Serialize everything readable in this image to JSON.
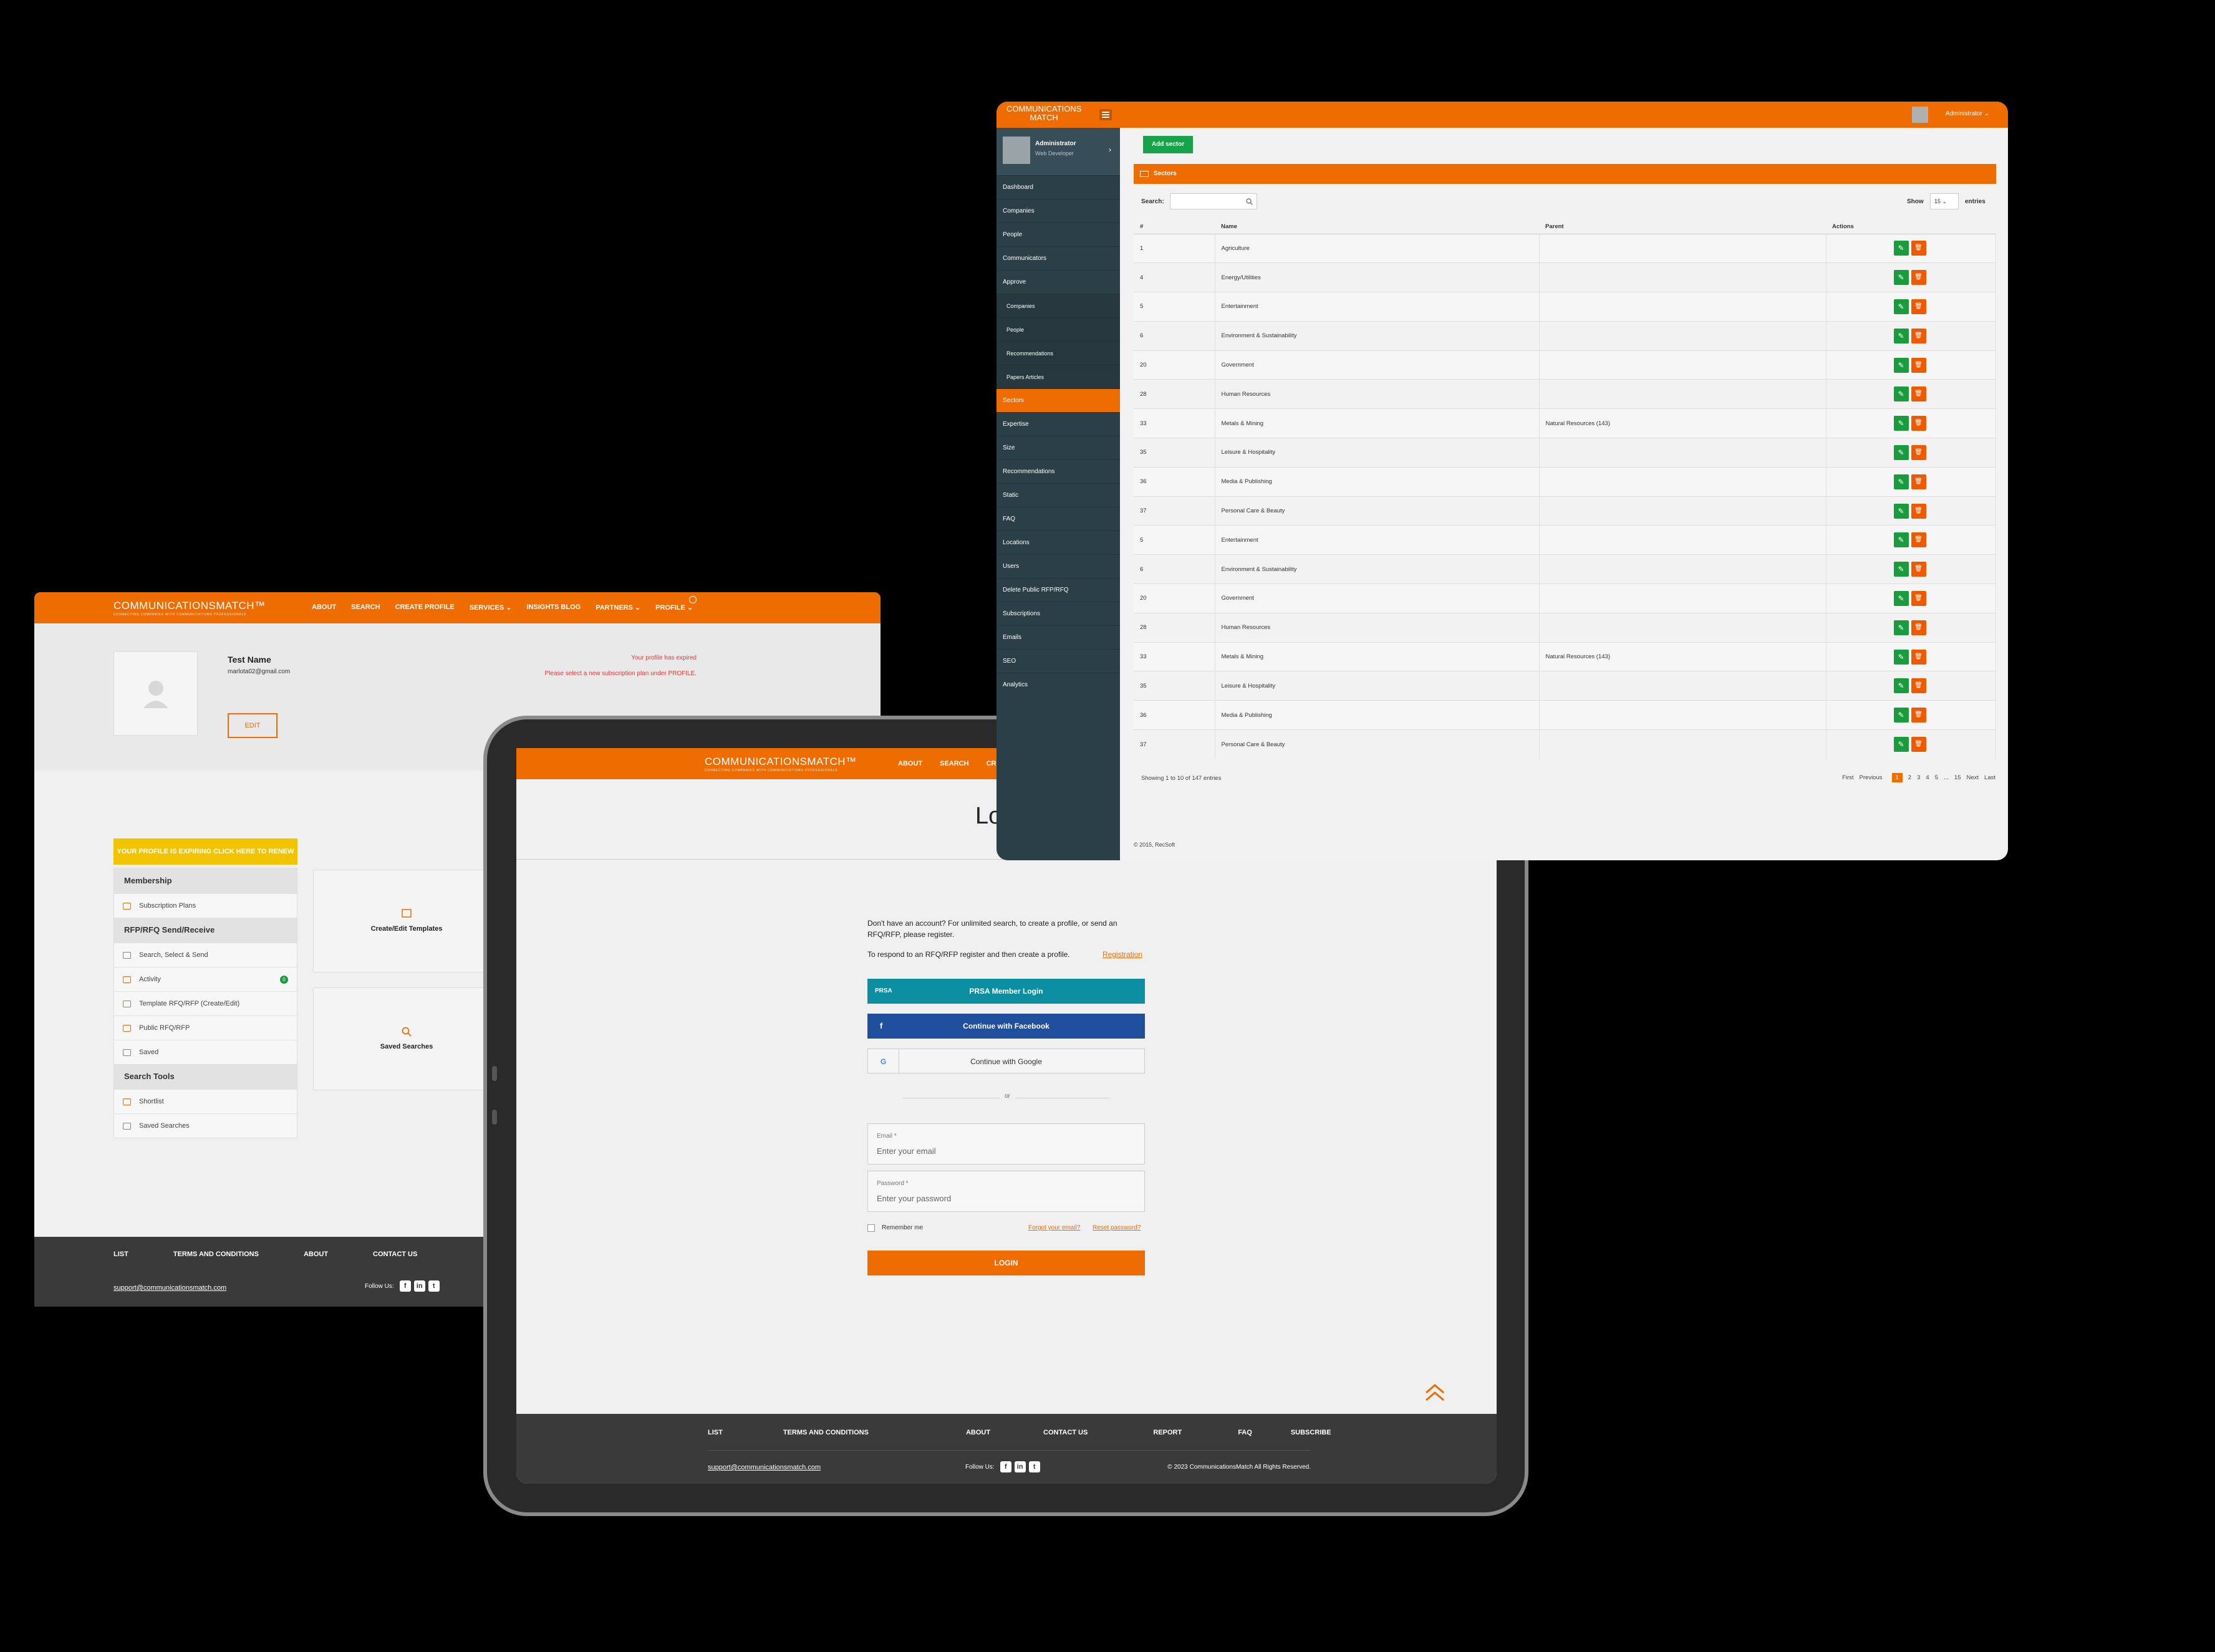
{
  "colors": {
    "brand": "#ef6c00",
    "sidebar": "#2b3f47",
    "edit": "#1a9c3e",
    "delete": "#ef5a00",
    "facebook": "#1f4f9d",
    "prsa": "#0b8fa0",
    "renew": "#f2c400"
  },
  "logo": {
    "name": "COMMUNICATIONSMATCH",
    "mark": "™",
    "tagline": "CONNECTING COMPANIES WITH COMMUNICATIONS PROFESSIONALS"
  },
  "profile": {
    "nav": [
      "ABOUT",
      "SEARCH",
      "CREATE PROFILE",
      "SERVICES ⌄",
      "INSIGHTS BLOG",
      "PARTNERS ⌄",
      "PROFILE ⌄"
    ],
    "name": "Test Name",
    "email": "marlota02@gmail.com",
    "expired_msg": "Your profile has expired",
    "subscribe_msg": "Please select a new subscription plan under PROFILE.",
    "edit": "EDIT",
    "renew": "YOUR PROFILE IS EXPIRING CLICK HERE TO RENEW",
    "sections": [
      {
        "title": "Membership",
        "items": [
          "Subscription Plans"
        ]
      },
      {
        "title": "RFP/RFQ Send/Receive",
        "items": [
          "Search, Select & Send",
          "Activity",
          "Template RFQ/RFP (Create/Edit)",
          "Public RFQ/RFP",
          "Saved"
        ]
      },
      {
        "title": "Search Tools",
        "items": [
          "Shortlist",
          "Saved Searches"
        ]
      }
    ],
    "activity_badge": "0",
    "cards": [
      "Create/Edit Templates",
      "Saved Searches"
    ],
    "footer": {
      "links": [
        "LIST",
        "TERMS AND CONDITIONS",
        "ABOUT",
        "CONTACT US"
      ],
      "email": "support@communicationsmatch.com",
      "follow": "Follow Us:"
    }
  },
  "login": {
    "nav": [
      "ABOUT",
      "SEARCH",
      "CRE"
    ],
    "title": "Lo",
    "intro": "Don't have an account? For unlimited search, to create a profile, or send an RFQ/RFP, please register.",
    "respond": "To respond to an RFQ/RFP register and then create a profile.",
    "registration": "Registration",
    "prsa": "PRSA Member Login",
    "prsa_logo": "PRSA",
    "facebook": "Continue with Facebook",
    "google": "Continue with Google",
    "or": "or",
    "email_label": "Email *",
    "email_ph": "Enter your email",
    "password_label": "Password *",
    "password_ph": "Enter your password",
    "remember": "Remember me",
    "forgot": "Forgot your email?",
    "reset": "Reset password?",
    "login": "LOGIN",
    "footer": {
      "links": [
        "LIST",
        "TERMS AND CONDITIONS",
        "ABOUT",
        "CONTACT US",
        "REPORT",
        "FAQ",
        "SUBSCRIBE"
      ],
      "email": "support@communicationsmatch.com",
      "follow": "Follow Us:",
      "copyright": "© 2023 CommunicationsMatch All Rights Reserved."
    }
  },
  "admin": {
    "logo_top": "COMMUNICATIONS",
    "logo_bottom": "MATCH",
    "user": "Administrator ⌄",
    "side_user": "Administrator",
    "side_role": "Web Developer",
    "menu": [
      {
        "label": "Dashboard",
        "type": "item"
      },
      {
        "label": "Companies",
        "type": "item"
      },
      {
        "label": "People",
        "type": "item"
      },
      {
        "label": "Communicators",
        "type": "item"
      },
      {
        "label": "Approve",
        "type": "item"
      },
      {
        "label": "Companies",
        "type": "sub"
      },
      {
        "label": "People",
        "type": "sub"
      },
      {
        "label": "Recommendations",
        "type": "sub"
      },
      {
        "label": "Papers Articles",
        "type": "sub"
      },
      {
        "label": "Sectors",
        "type": "active"
      },
      {
        "label": "Expertise",
        "type": "item"
      },
      {
        "label": "Size",
        "type": "item"
      },
      {
        "label": "Recommendations",
        "type": "item"
      },
      {
        "label": "Static",
        "type": "item"
      },
      {
        "label": "FAQ",
        "type": "item"
      },
      {
        "label": "Locations",
        "type": "item"
      },
      {
        "label": "Users",
        "type": "item"
      },
      {
        "label": "Delete Public RFP/RFQ",
        "type": "item"
      },
      {
        "label": "Subscriptions",
        "type": "item"
      },
      {
        "label": "Emails",
        "type": "item"
      },
      {
        "label": "SEO",
        "type": "item"
      },
      {
        "label": "Analytics",
        "type": "item"
      }
    ],
    "add": "Add sector",
    "panel": "Sectors",
    "search": "Search:",
    "show": "Show",
    "show_val": "15 ⌄",
    "entries": "entries",
    "headers": [
      "#",
      "Name",
      "Parent",
      "Actions"
    ],
    "rows": [
      [
        "1",
        "Agriculture",
        ""
      ],
      [
        "4",
        "Energy/Utilities",
        ""
      ],
      [
        "5",
        "Entertainment",
        ""
      ],
      [
        "6",
        "Environment & Sustainability",
        ""
      ],
      [
        "20",
        "Government",
        ""
      ],
      [
        "28",
        "Human Resources",
        ""
      ],
      [
        "33",
        "Metals & Mining",
        "Natural Resources (143)"
      ],
      [
        "35",
        "Leisure & Hospitality",
        ""
      ],
      [
        "36",
        "Media & Publishing",
        ""
      ],
      [
        "37",
        "Personal Care & Beauty",
        ""
      ],
      [
        "5",
        "Entertainment",
        ""
      ],
      [
        "6",
        "Environment & Sustainability",
        ""
      ],
      [
        "20",
        "Government",
        ""
      ],
      [
        "28",
        "Human Resources",
        ""
      ],
      [
        "33",
        "Metals & Mining",
        "Natural Resources (143)"
      ],
      [
        "35",
        "Leisure & Hospitality",
        ""
      ],
      [
        "36",
        "Media & Publishing",
        ""
      ],
      [
        "37",
        "Personal Care & Beauty",
        ""
      ]
    ],
    "showing": "Showing 1 to 10 of 147 entries",
    "pager": [
      "First",
      "Previous",
      "1",
      "2",
      "3",
      "4",
      "5",
      "...",
      "15",
      "Next",
      "Last"
    ],
    "current_page": "1",
    "copyright": "© 2015, RecSoft"
  }
}
